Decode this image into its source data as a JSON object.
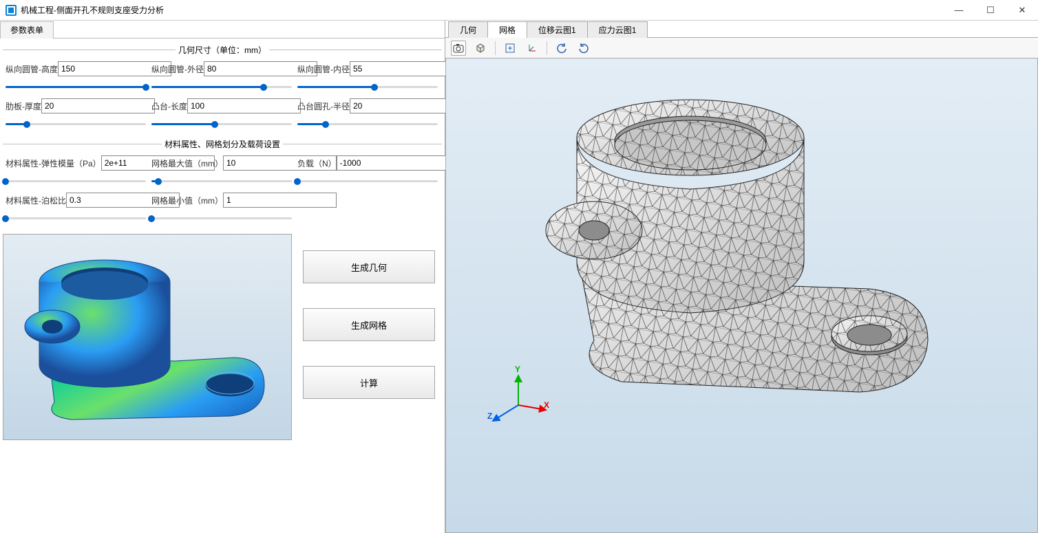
{
  "window": {
    "title": "机械工程-侧面开孔不规则支座受力分析",
    "minimize_tip": "Minimize",
    "maximize_tip": "Maximize",
    "close_tip": "Close"
  },
  "left_panel": {
    "tab_label": "参数表单",
    "sections": {
      "geometry": {
        "title": "几何尺寸（单位：mm）",
        "params": [
          {
            "label": "纵向圆管-高度",
            "value": "150",
            "slider": 100
          },
          {
            "label": "纵向圆管-外径",
            "value": "80",
            "slider": 80
          },
          {
            "label": "纵向圆管-内径",
            "value": "55",
            "slider": 55
          },
          {
            "label": "肋板-厚度",
            "value": "20",
            "slider": 15
          },
          {
            "label": "凸台-长度",
            "value": "100",
            "slider": 45
          },
          {
            "label": "凸台圆孔-半径",
            "value": "20",
            "slider": 20
          }
        ]
      },
      "material": {
        "title": "材料属性、网格划分及载荷设置",
        "params": [
          {
            "label": "材料属性-弹性模量（Pa）",
            "value": "2e+11",
            "slider": 0
          },
          {
            "label": "网格最大值（mm）",
            "value": "10",
            "slider": 5
          },
          {
            "label": "负载（N）",
            "value": "-1000",
            "slider": 0
          },
          {
            "label": "材料属性-泊松比",
            "value": "0.3",
            "slider": 0
          },
          {
            "label": "网格最小值（mm）",
            "value": "1",
            "slider": 0
          }
        ]
      }
    },
    "buttons": {
      "gen_geometry": "生成几何",
      "gen_mesh": "生成网格",
      "compute": "计算"
    }
  },
  "right_panel": {
    "tabs": [
      {
        "id": "geom",
        "label": "几何",
        "active": false
      },
      {
        "id": "mesh",
        "label": "网格",
        "active": true
      },
      {
        "id": "disp",
        "label": "位移云图1",
        "active": false
      },
      {
        "id": "stress",
        "label": "应力云图1",
        "active": false
      }
    ],
    "toolbar": {
      "camera_icon": "camera-icon",
      "cube_icon": "cube-icon",
      "fit_icon": "fit-view-icon",
      "axes_icon": "axes-icon",
      "rot_ccw_icon": "rotate-ccw-icon",
      "rot_cw_icon": "rotate-cw-icon"
    },
    "triad": {
      "x": "X",
      "y": "Y",
      "z": "Z"
    }
  }
}
